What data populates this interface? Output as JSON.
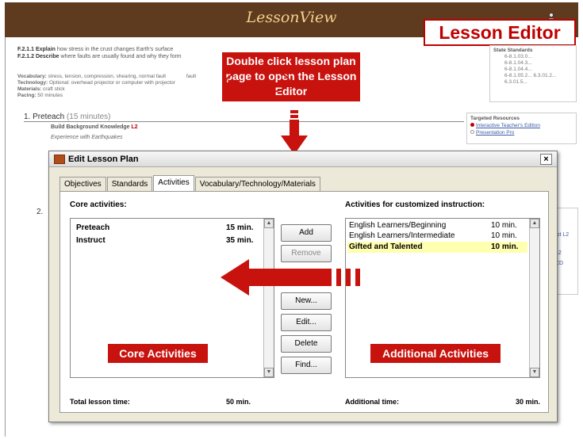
{
  "header": {
    "app_title": "LessonView",
    "badge": "Lesson Editor"
  },
  "background_page": {
    "standard1_code": "F.2.1.1",
    "standard1_verb": "Explain",
    "standard1_text": "how stress in the crust changes Earth's surface",
    "standard2_code": "F.2.1.2",
    "standard2_verb": "Describe",
    "standard2_text": "where faults are usually found and why they form",
    "vocab_label": "Vocabulary:",
    "vocab_value": "stress, tension, compression, shearing, normal fault",
    "vocab_trailing": "fault",
    "tech_label": "Technology:",
    "tech_value": "Optional: overhead projector or computer with projector",
    "materials_label": "Materials:",
    "materials_value": "craft stick",
    "pacing_label": "Pacing:",
    "pacing_value": "50 minutes",
    "state_standards_title": "State Standards",
    "state_standards": [
      "6-8.1.03.0...",
      "6-8.1.04.3...",
      "6-8.1.04.4...",
      "6-8.1.05.2... 6.3.01.2...",
      "6.3.01.5..."
    ],
    "section1_title": "1.  Preteach",
    "section1_time": "(15 minutes)",
    "build_bg": "Build Background Knowledge",
    "build_bg_level": "L2",
    "experience": "Experience with Earthquakes",
    "targeted_title": "Targeted Resources",
    "targeted_1": "Interactive Teacher's Edition",
    "targeted_2": "Presentation Pro",
    "section2_num": "2.",
    "side_link_1": "lot L2",
    "side_link_2": "L2",
    "side_link_3": "CD"
  },
  "callout": {
    "text": "Double click lesson plan page to open the Lesson Editor"
  },
  "dialog": {
    "title": "Edit Lesson Plan",
    "close": "×",
    "tabs": [
      "Objectives",
      "Standards",
      "Activities",
      "Vocabulary/Technology/Materials"
    ],
    "active_tab": "Activities",
    "core_label": "Core activities:",
    "core_items": [
      {
        "name": "Preteach",
        "time": "15 min."
      },
      {
        "name": "Instruct",
        "time": "35 min."
      }
    ],
    "custom_label": "Activities for customized instruction:",
    "custom_items": [
      {
        "name": "English Learners/Beginning",
        "time": "10 min."
      },
      {
        "name": "English Learners/Intermediate",
        "time": "10 min."
      },
      {
        "name": "Gifted and Talented",
        "time": "10 min."
      }
    ],
    "buttons": {
      "add": "Add",
      "remove": "Remove",
      "new": "New...",
      "edit": "Edit...",
      "delete": "Delete",
      "find": "Find..."
    },
    "core_overlay": "Core Activities",
    "additional_overlay": "Additional Activities",
    "total_label": "Total lesson time:",
    "total_value": "50 min.",
    "additional_label": "Additional time:",
    "additional_value": "30 min."
  }
}
